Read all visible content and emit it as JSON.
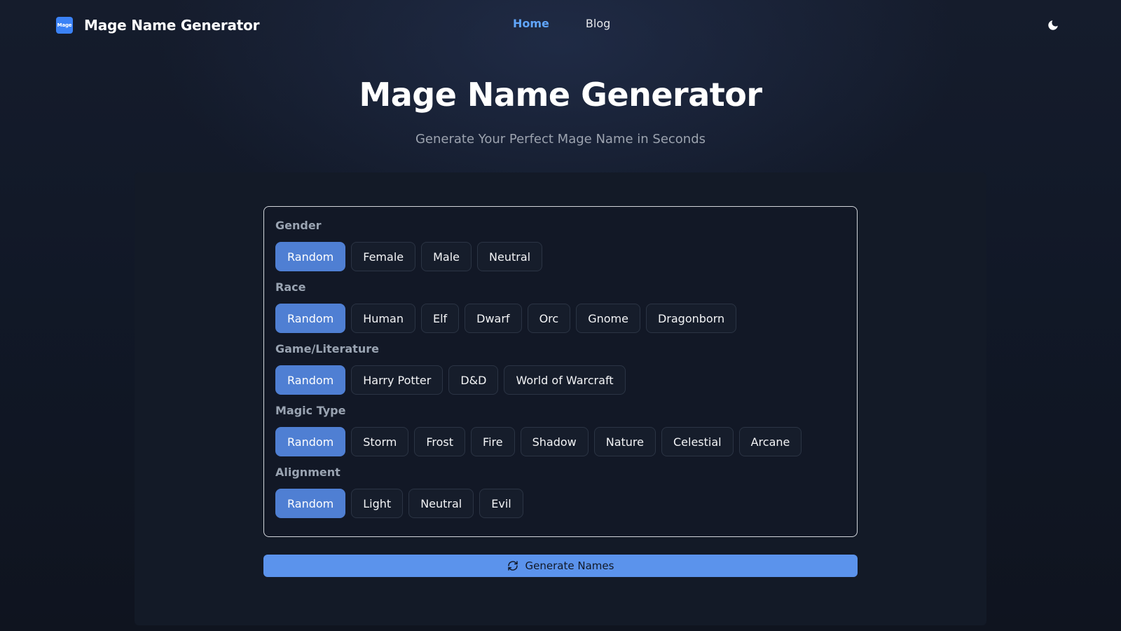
{
  "header": {
    "logo_text": "Mage",
    "brand_name": "Mage Name Generator",
    "nav": [
      {
        "label": "Home",
        "active": true
      },
      {
        "label": "Blog",
        "active": false
      }
    ],
    "theme_icon": "moon-icon"
  },
  "hero": {
    "title": "Mage Name Generator",
    "subtitle": "Generate Your Perfect Mage Name in Seconds"
  },
  "options": {
    "gender": {
      "label": "Gender",
      "selected": "Random",
      "choices": [
        "Random",
        "Female",
        "Male",
        "Neutral"
      ]
    },
    "race": {
      "label": "Race",
      "selected": "Random",
      "choices": [
        "Random",
        "Human",
        "Elf",
        "Dwarf",
        "Orc",
        "Gnome",
        "Dragonborn"
      ]
    },
    "game": {
      "label": "Game/Literature",
      "selected": "Random",
      "choices": [
        "Random",
        "Harry Potter",
        "D&D",
        "World of Warcraft"
      ]
    },
    "magic": {
      "label": "Magic Type",
      "selected": "Random",
      "choices": [
        "Random",
        "Storm",
        "Frost",
        "Fire",
        "Shadow",
        "Nature",
        "Celestial",
        "Arcane"
      ]
    },
    "alignment": {
      "label": "Alignment",
      "selected": "Random",
      "choices": [
        "Random",
        "Light",
        "Neutral",
        "Evil"
      ]
    }
  },
  "generate": {
    "label": "Generate Names",
    "icon": "refresh-icon"
  },
  "colors": {
    "accent": "#60a5fa",
    "selected_option": "#4f7fd3",
    "generate_button": "#5b93ec",
    "background": "#111827"
  }
}
